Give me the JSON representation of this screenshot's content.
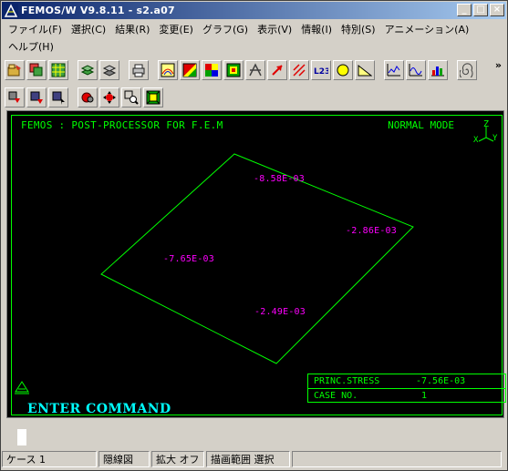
{
  "window": {
    "title": "FEMOS/W V9.8.11 - s2.a07",
    "controls": {
      "minimize": "_",
      "maximize": "□",
      "close": "×"
    }
  },
  "menu": {
    "row1": [
      "ファイル(F)",
      "選択(C)",
      "結果(R)",
      "変更(E)",
      "グラフ(G)",
      "表示(V)",
      "情報(I)",
      "特別(S)",
      "アニメーション(A)"
    ],
    "row2": [
      "ヘルプ(H)"
    ]
  },
  "toolbar": {
    "row1_icons": [
      "open-icon",
      "copy-icon",
      "grid-icon",
      "layers-icon",
      "layers2-icon",
      "print-icon",
      "contour-icon",
      "contour-fill-icon",
      "grid-color-icon",
      "mesh-color-icon",
      "deform-icon",
      "arrow-icon",
      "vector-icon",
      "label-l23-icon",
      "circle-icon",
      "ruler-icon",
      "graph-line-icon",
      "graph-wave-icon",
      "graph-bar-icon",
      "spiral-icon"
    ],
    "row2_icons": [
      "step-down-icon",
      "step-down-alt-icon",
      "step-cursor-icon",
      "pan-icon",
      "move-icon",
      "zoom-icon",
      "fit-icon"
    ],
    "more": "»"
  },
  "viewport": {
    "header_left": "FEMOS : POST-PROCESSOR FOR F.E.M",
    "header_right": "NORMAL MODE",
    "axis": {
      "z": "Z",
      "x": "X",
      "y": "Y"
    },
    "values": {
      "top": "-8.58E-03",
      "right": "-2.86E-03",
      "left": "-7.65E-03",
      "bottom": "-2.49E-03"
    },
    "info": {
      "label1": "PRINC.STRESS",
      "value1": "-7.56E-03",
      "label2": "CASE NO.",
      "value2": "1"
    },
    "command": "ENTER COMMAND",
    "colors": {
      "bg": "#000000",
      "line": "#00ff00",
      "value": "#ff00ff",
      "command": "#00ffff"
    }
  },
  "status": {
    "cells": [
      "ケース 1",
      "隠線図",
      "拡大 オフ",
      "描画範囲 選択",
      ""
    ]
  }
}
